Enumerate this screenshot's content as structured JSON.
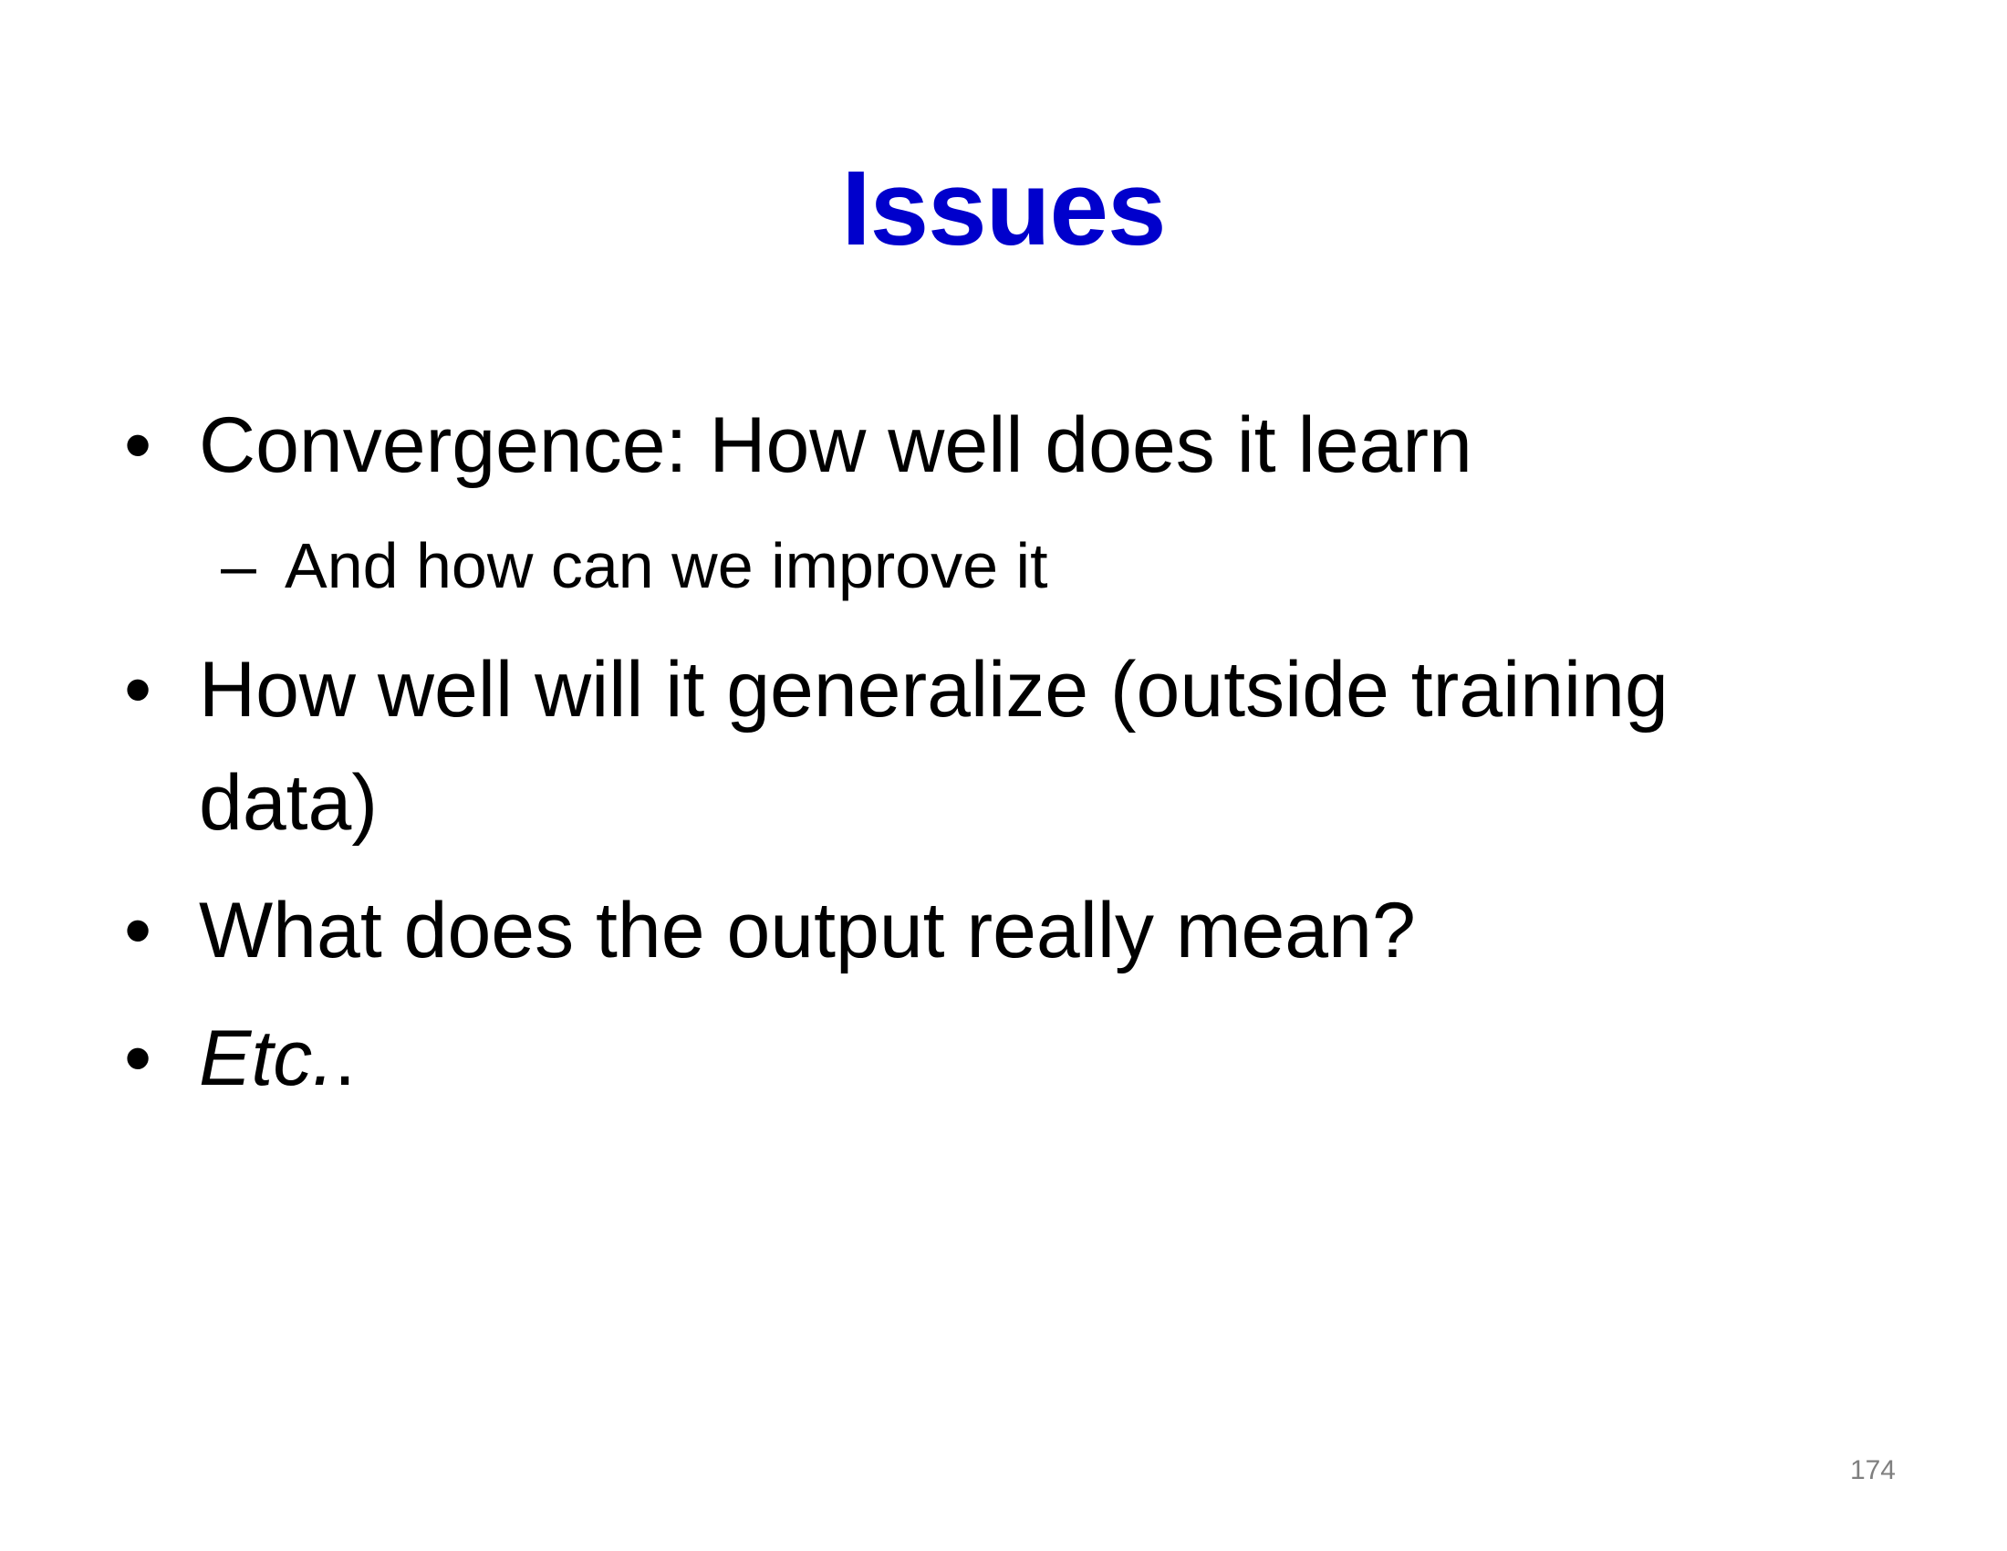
{
  "slide": {
    "title": "Issues",
    "bullets": [
      {
        "marker": "•",
        "text": "Convergence: How well does it learn",
        "subitems": [
          {
            "marker": "–",
            "text": "And how can we improve it"
          }
        ]
      },
      {
        "marker": "•",
        "text_line1": "How well will it generalize (outside training",
        "text_line2": "data)"
      },
      {
        "marker": "•",
        "text": "What does the output really mean?"
      },
      {
        "marker": "•",
        "text_italic": "Etc.",
        "text_suffix": "."
      }
    ],
    "page_number": "174"
  },
  "colors": {
    "title": "#0000CC",
    "body_text": "#000000",
    "page_number": "#7f7f7f",
    "background": "#ffffff"
  }
}
